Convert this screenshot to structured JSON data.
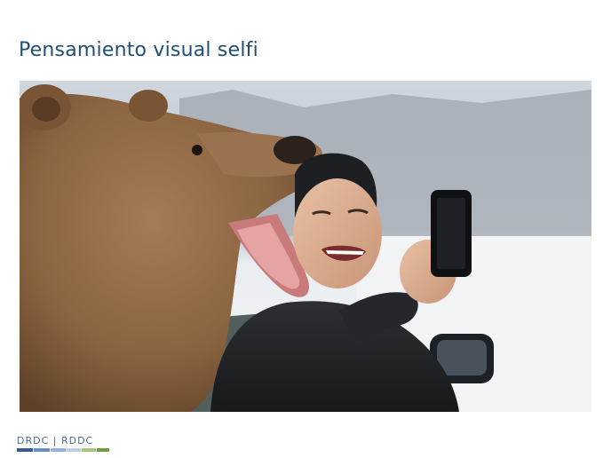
{
  "slide": {
    "title": "Pensamiento visual selfi"
  },
  "footer": {
    "logo_text": "DRDC | RDDC"
  },
  "colors": {
    "title": "#1f4e79",
    "logo_text": "#4a6a8a",
    "logo_bar": [
      "#3b5b8c",
      "#5f8fc4",
      "#8fb3dc",
      "#b9d0eb",
      "#a6c47a",
      "#6f9c45"
    ]
  }
}
